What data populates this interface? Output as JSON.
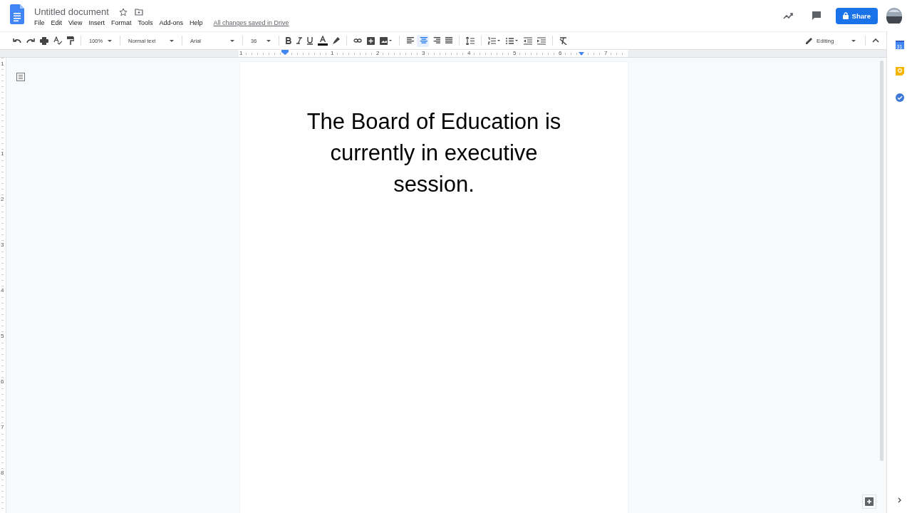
{
  "document": {
    "title": "Untitled document",
    "starred": false,
    "save_status": "All changes saved in Drive",
    "body": "The Board of Education is currently in executive session."
  },
  "menu": [
    "File",
    "Edit",
    "View",
    "Insert",
    "Format",
    "Tools",
    "Add-ons",
    "Help"
  ],
  "header_actions": {
    "share_label": "Share"
  },
  "toolbar": {
    "zoom": "100%",
    "style": "Normal text",
    "font": "Arial",
    "size": "36",
    "mode": "Editing",
    "alignments": [
      {
        "kind": "left",
        "selected": false
      },
      {
        "kind": "center",
        "selected": true
      },
      {
        "kind": "right",
        "selected": false
      },
      {
        "kind": "justify",
        "selected": false
      }
    ]
  },
  "horizontal_ruler": [
    "1",
    "1",
    "2",
    "3",
    "4",
    "5",
    "6",
    "7"
  ],
  "vertical_ruler": [
    "1",
    "1",
    "2",
    "3",
    "4",
    "5",
    "6",
    "7",
    "8"
  ],
  "side_panel": {
    "calendar_day": "31"
  }
}
